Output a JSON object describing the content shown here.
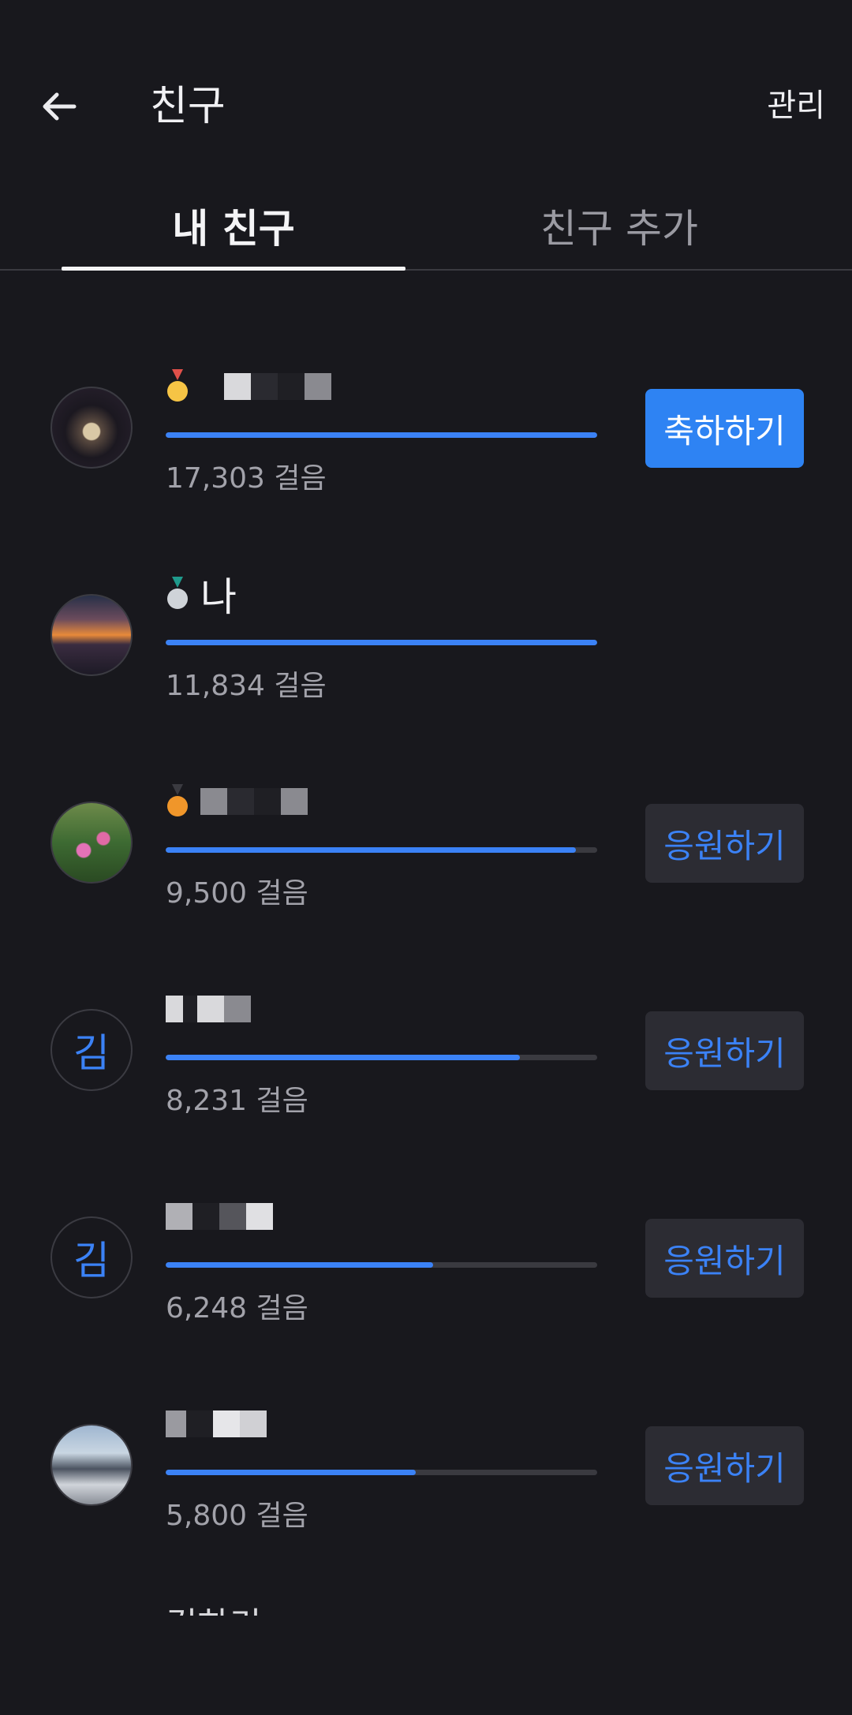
{
  "header": {
    "back_icon": "arrow-left-icon",
    "title": "친구",
    "manage_label": "관리"
  },
  "tabs": [
    {
      "label": "내 친구",
      "active": true
    },
    {
      "label": "친구 추가",
      "active": false
    }
  ],
  "colors": {
    "background": "#18181d",
    "accent": "#3b82f6",
    "primary_button": "#2e83f3",
    "secondary_button": "#2c2c33",
    "track": "#3a3a40"
  },
  "friends": [
    {
      "medal_icon": "gold-medal-icon",
      "name": "",
      "name_redacted": true,
      "avatar_icon": "opera-house-night-photo",
      "progress": 1.0,
      "steps": "17,303 걸음",
      "action_label": "축하하기",
      "action_style": "primary"
    },
    {
      "medal_icon": "silver-medal-icon",
      "name": "나",
      "name_redacted": false,
      "avatar_icon": "sunset-mountain-photo",
      "progress": 1.0,
      "steps": "11,834 걸음",
      "action_label": "",
      "action_style": "none"
    },
    {
      "medal_icon": "bronze-medal-icon",
      "name": "",
      "name_redacted": true,
      "avatar_icon": "pink-flowers-photo",
      "progress": 0.95,
      "steps": "9,500 걸음",
      "action_label": "응원하기",
      "action_style": "secondary"
    },
    {
      "medal_icon": "",
      "name": "",
      "name_redacted": true,
      "avatar_letter": "김",
      "progress": 0.82,
      "steps": "8,231 걸음",
      "action_label": "응원하기",
      "action_style": "secondary"
    },
    {
      "medal_icon": "",
      "name": "",
      "name_redacted": true,
      "avatar_letter": "김",
      "progress": 0.62,
      "steps": "6,248 걸음",
      "action_label": "응원하기",
      "action_style": "secondary"
    },
    {
      "medal_icon": "",
      "name": "",
      "name_redacted": true,
      "avatar_icon": "snowy-mountain-photo",
      "progress": 0.58,
      "steps": "5,800 걸음",
      "action_label": "응원하기",
      "action_style": "secondary"
    }
  ],
  "truncated_next_name": "김하리"
}
